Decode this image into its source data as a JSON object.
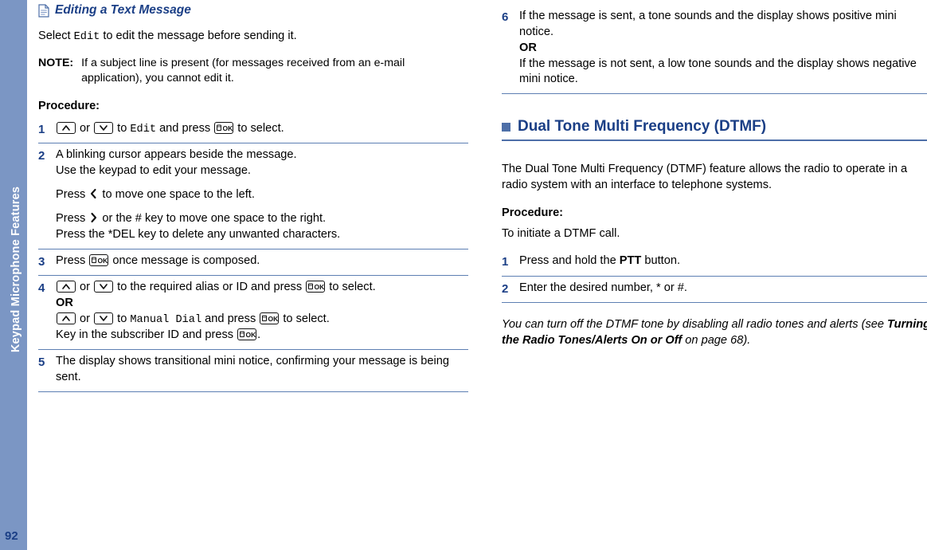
{
  "sidebar": {
    "chapter_label": "Keypad Microphone Features",
    "page_number": "92"
  },
  "left_column": {
    "section_title": "Editing a Text Message",
    "intro_pre": "Select ",
    "intro_mono": "Edit",
    "intro_post": " to edit the message before sending it.",
    "note": {
      "label": "NOTE:",
      "text": "If a subject line is present (for messages received from an e-mail application), you cannot edit it."
    },
    "procedure_label": "Procedure:",
    "steps": [
      {
        "num": "1",
        "parts": [
          {
            "t": "key-updown"
          },
          {
            "t": "text",
            "v": " or "
          },
          {
            "t": "key-downarrow"
          },
          {
            "t": "text",
            "v": " to "
          },
          {
            "t": "mono",
            "v": "Edit"
          },
          {
            "t": "text",
            "v": " and press "
          },
          {
            "t": "key-ok"
          },
          {
            "t": "text",
            "v": " to select."
          }
        ]
      },
      {
        "num": "2",
        "lines": [
          "A blinking cursor appears beside the message.",
          "Use the keypad to edit your message."
        ],
        "line3_pre": "Press ",
        "line3_post": " to move one space to the left.",
        "line4_pre": "Press ",
        "line4_post": " or the # key to move one space to the right.",
        "line5": "Press the *DEL key to delete any unwanted characters."
      },
      {
        "num": "3",
        "pre": "Press ",
        "post": " once message is composed."
      },
      {
        "num": "4",
        "l1_mid": " or ",
        "l1_to": " to the required alias or ID and press ",
        "l1_end": " to select.",
        "or": "OR",
        "l2_mid": " or ",
        "l2_to": " to ",
        "l2_mono": "Manual Dial",
        "l2_press": " and press ",
        "l2_end": " to select.",
        "l3_pre": "Key in the subscriber ID and press ",
        "l3_end": "."
      },
      {
        "num": "5",
        "text": "The display shows transitional mini notice, confirming your message is being sent."
      }
    ]
  },
  "right_column": {
    "step6": {
      "num": "6",
      "line1": "If the message is sent, a tone sounds and the display shows positive mini notice.",
      "or": "OR",
      "line2": "If the message is not sent, a low tone sounds and the display shows negative mini notice."
    },
    "chapter_title": "Dual Tone Multi Frequency (DTMF)",
    "paragraph": "The Dual Tone Multi Frequency (DTMF) feature allows the radio to operate in a radio system with an interface to telephone systems.",
    "procedure_label": "Procedure:",
    "lead_in": "To initiate a DTMF call.",
    "steps": [
      {
        "num": "1",
        "pre": "Press and hold the ",
        "bold": "PTT",
        "post": " button."
      },
      {
        "num": "2",
        "text": "Enter the desired number, * or #."
      }
    ],
    "italic_note": {
      "pre": "You can turn off the DTMF tone by disabling all radio tones and alerts (see ",
      "bold": "Turning the Radio Tones/Alerts On or Off",
      "mid": " on page 68)."
    }
  },
  "colors": {
    "accent_blue": "#1b3f86",
    "rule_blue": "#5d7fb3",
    "tab_blue": "#7b96c4",
    "square_blue": "#4e6fa8"
  },
  "icons": {
    "document": "document-icon",
    "ok_key": "ok-key-icon",
    "up_key": "up-arrow-key-icon",
    "down_key": "down-arrow-key-icon",
    "left_arrow": "left-arrow-icon",
    "right_arrow": "right-arrow-icon"
  }
}
